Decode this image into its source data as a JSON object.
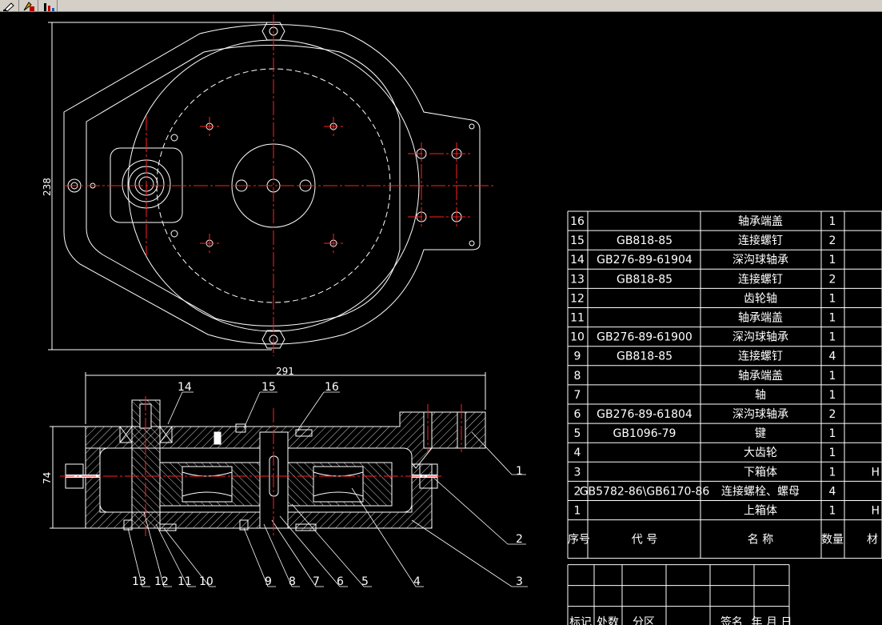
{
  "toolbar": {
    "buttons": [
      {
        "icon": "pen-tool-icon"
      },
      {
        "icon": "text-style-icon"
      },
      {
        "icon": "chart-style-icon"
      }
    ]
  },
  "drawing": {
    "dims": {
      "height_top": "238",
      "width_bottom": "291",
      "height_bottom": "74"
    },
    "balloons": {
      "b14": "14",
      "b15": "15",
      "b16": "16",
      "b1": "1",
      "b2": "2",
      "b3": "3",
      "b4": "4",
      "b5": "5",
      "b6": "6",
      "b7": "7",
      "b8": "8",
      "b9": "9",
      "b10": "10",
      "b11": "11",
      "b12": "12",
      "b13": "13"
    }
  },
  "bom": {
    "header": {
      "no": "序号",
      "code": "代 号",
      "name": "名 称",
      "qty": "数量",
      "extra": "材"
    },
    "rows": [
      {
        "no": "16",
        "code": "",
        "name": "轴承端盖",
        "qty": "1",
        "extra": ""
      },
      {
        "no": "15",
        "code": "GB818-85",
        "name": "连接螺钉",
        "qty": "2",
        "extra": ""
      },
      {
        "no": "14",
        "code": "GB276-89-61904",
        "name": "深沟球轴承",
        "qty": "1",
        "extra": ""
      },
      {
        "no": "13",
        "code": "GB818-85",
        "name": "连接螺钉",
        "qty": "2",
        "extra": ""
      },
      {
        "no": "12",
        "code": "",
        "name": "齿轮轴",
        "qty": "1",
        "extra": ""
      },
      {
        "no": "11",
        "code": "",
        "name": "轴承端盖",
        "qty": "1",
        "extra": ""
      },
      {
        "no": "10",
        "code": "GB276-89-61900",
        "name": "深沟球轴承",
        "qty": "1",
        "extra": ""
      },
      {
        "no": "9",
        "code": "GB818-85",
        "name": "连接螺钉",
        "qty": "4",
        "extra": ""
      },
      {
        "no": "8",
        "code": "",
        "name": "轴承端盖",
        "qty": "1",
        "extra": ""
      },
      {
        "no": "7",
        "code": "",
        "name": "轴",
        "qty": "1",
        "extra": ""
      },
      {
        "no": "6",
        "code": "GB276-89-61804",
        "name": "深沟球轴承",
        "qty": "2",
        "extra": ""
      },
      {
        "no": "5",
        "code": "GB1096-79",
        "name": "键",
        "qty": "1",
        "extra": ""
      },
      {
        "no": "4",
        "code": "",
        "name": "大齿轮",
        "qty": "1",
        "extra": ""
      },
      {
        "no": "3",
        "code": "",
        "name": "下箱体",
        "qty": "1",
        "extra": "H"
      },
      {
        "no": "2",
        "code": "GB5782-86\\GB6170-86",
        "name": "连接螺栓、螺母",
        "qty": "4",
        "extra": ""
      },
      {
        "no": "1",
        "code": "",
        "name": "上箱体",
        "qty": "1",
        "extra": "H"
      }
    ],
    "title_block": {
      "labels": [
        "标记",
        "处数",
        "分区",
        "",
        "签名",
        "年 月 日"
      ]
    }
  },
  "colors": {
    "line": "#ffffff",
    "center": "#ff2020",
    "background": "#000000"
  }
}
